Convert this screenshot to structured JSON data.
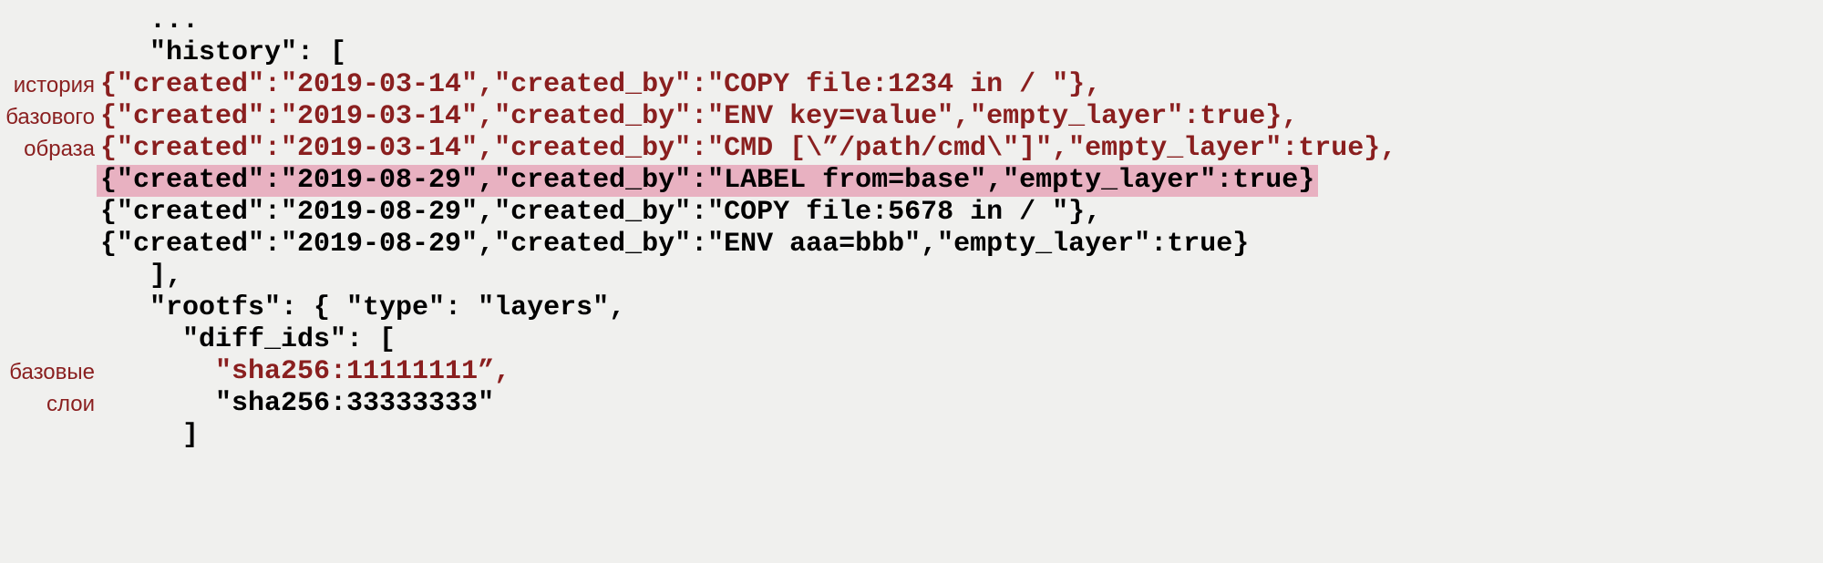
{
  "annotations": {
    "history_l1": "история",
    "history_l2": "базового",
    "history_l3": "образа",
    "layers_l1": "базовые",
    "layers_l2": "слои"
  },
  "code": {
    "l0": "   ...",
    "l1": "   \"history\": [",
    "l2": "{\"created\":\"2019-03-14\",\"created_by\":\"COPY file:1234 in / \"},",
    "l3": "{\"created\":\"2019-03-14\",\"created_by\":\"ENV key=value\",\"empty_layer\":true},",
    "l4": "{\"created\":\"2019-03-14\",\"created_by\":\"CMD [\\”/path/cmd\\\"]\",\"empty_layer\":true},",
    "l5": "{\"created\":\"2019-08-29\",\"created_by\":\"LABEL from=base\",\"empty_layer\":true}",
    "l6": "{\"created\":\"2019-08-29\",\"created_by\":\"COPY file:5678 in / \"},",
    "l7": "{\"created\":\"2019-08-29\",\"created_by\":\"ENV aaa=bbb\",\"empty_layer\":true}",
    "l8": "   ],",
    "l9": "   \"rootfs\": { \"type\": \"layers\",",
    "l10": "     \"diff_ids\": [",
    "l11": "       \"sha256:11111111”,",
    "l12": "       \"sha256:33333333\"",
    "l13": "     ]"
  }
}
